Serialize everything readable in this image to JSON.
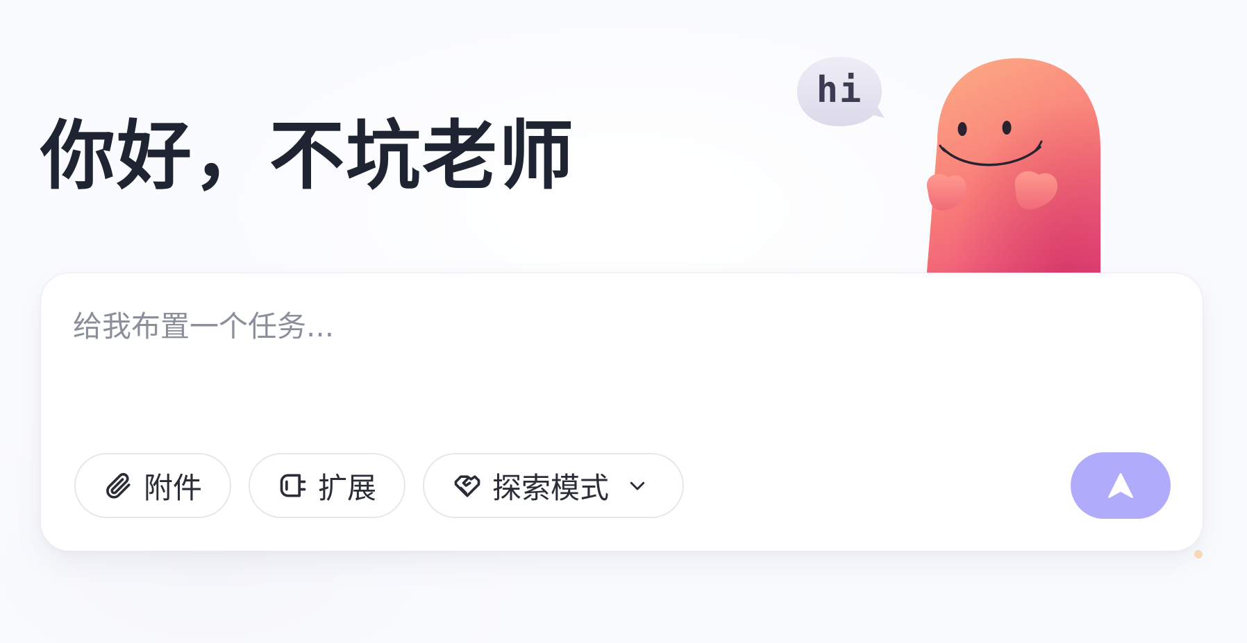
{
  "greeting": {
    "title": "你好，不坑老师"
  },
  "mascot": {
    "speech_text": "hi",
    "icon": "smiling-blob-mascot"
  },
  "composer": {
    "input_value": "",
    "input_placeholder": "给我布置一个任务...",
    "attach_label": "附件",
    "extension_label": "扩展",
    "mode_label": "探索模式",
    "attach_icon": "paperclip-icon",
    "extension_icon": "plug-icon",
    "mode_icon": "handshake-icon",
    "send_icon": "arrow-up-icon"
  },
  "colors": {
    "send_button": "#b1abfb",
    "greeting_text": "#1e2431",
    "placeholder": "#8a8f9c"
  }
}
